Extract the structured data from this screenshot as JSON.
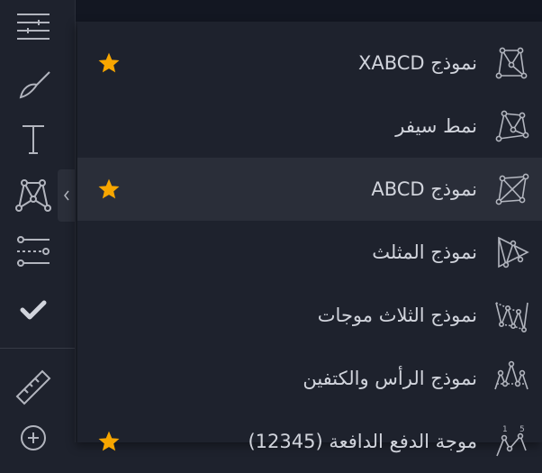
{
  "colors": {
    "accent_star": "#f7a600",
    "icon": "#b2b5be",
    "text": "#d1d4dc"
  },
  "toolbar": {
    "tools": [
      {
        "icon": "crosshair-lines-icon"
      },
      {
        "icon": "brush-icon"
      },
      {
        "icon": "text-icon"
      },
      {
        "icon": "pattern-icon"
      },
      {
        "icon": "prediction-measure-icon"
      },
      {
        "icon": "checkmark-icon"
      },
      {
        "icon": "ruler-icon"
      },
      {
        "icon": "zoom-in-icon"
      }
    ],
    "expand_icon": "chevron-left-icon"
  },
  "menu": {
    "items": [
      {
        "label": "نموذج XABCD",
        "icon": "xabcd-pattern-icon",
        "favorite": true,
        "active": false
      },
      {
        "label": "نمط سيفر",
        "icon": "cypher-pattern-icon",
        "favorite": false,
        "active": false
      },
      {
        "label": "نموذج ABCD",
        "icon": "abcd-pattern-icon",
        "favorite": true,
        "active": true
      },
      {
        "label": "نموذج المثلث",
        "icon": "triangle-pattern-icon",
        "favorite": false,
        "active": false
      },
      {
        "label": "نموذج الثلاث موجات",
        "icon": "three-drives-pattern-icon",
        "favorite": false,
        "active": false
      },
      {
        "label": "نموذج الرأس والكتفين",
        "icon": "head-and-shoulders-icon",
        "favorite": false,
        "active": false
      },
      {
        "label": "موجة الدفع الدافعة (12345)",
        "icon": "elliott-impulse-wave-icon",
        "favorite": true,
        "active": false
      }
    ]
  }
}
